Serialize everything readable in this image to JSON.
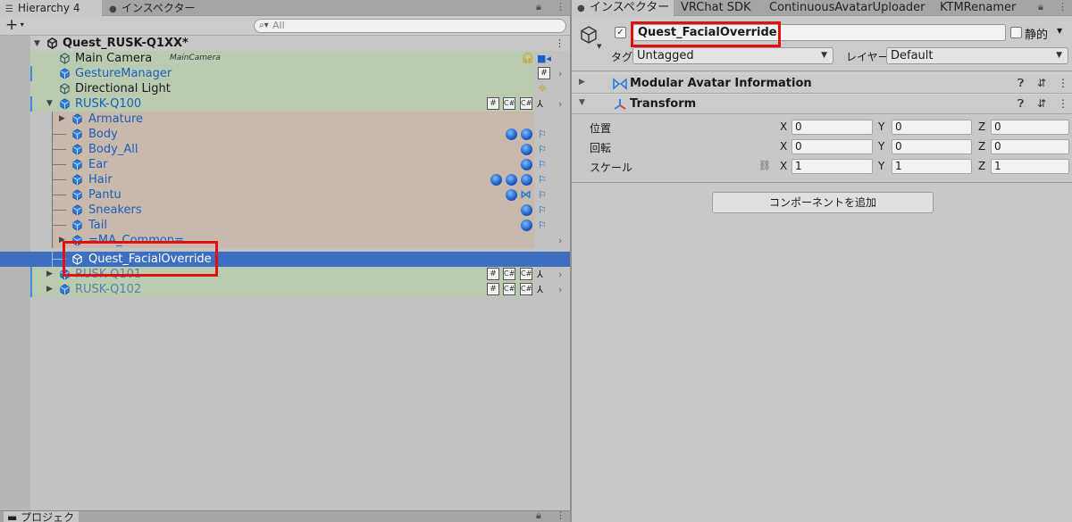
{
  "hierarchy": {
    "tab_label": "Hierarchy 4",
    "other_tab_label": "インスペクター",
    "add_label": "+",
    "search_placeholder": "All",
    "scene_name": "Quest_RUSK-Q1XX*",
    "items": [
      {
        "label": "Main Camera",
        "tag": "MainCamera"
      },
      {
        "label": "GestureManager"
      },
      {
        "label": "Directional Light"
      },
      {
        "label": "RUSK-Q100"
      },
      {
        "label": "Armature"
      },
      {
        "label": "Body"
      },
      {
        "label": "Body_All"
      },
      {
        "label": "Ear"
      },
      {
        "label": "Hair"
      },
      {
        "label": "Pantu"
      },
      {
        "label": "Sneakers"
      },
      {
        "label": "Tail"
      },
      {
        "label": "=MA_Common="
      },
      {
        "label": "Quest_FacialOverride"
      },
      {
        "label": "RUSK-Q101"
      },
      {
        "label": "RUSK-Q102"
      }
    ],
    "icon_glyphs": {
      "hash": "#",
      "script": "C#",
      "prefab": "⅄"
    }
  },
  "project": {
    "tab_label": "プロジェクト"
  },
  "inspector": {
    "tabs": [
      "インスペクター",
      "VRChat SDK",
      "ContinuousAvatarUploader",
      "KTMRenamer"
    ],
    "object_name": "Quest_FacialOverride",
    "active_checked": true,
    "static_label": "静的",
    "tag_label": "タグ",
    "tag_value": "Untagged",
    "layer_label": "レイヤー",
    "layer_value": "Default",
    "components": [
      {
        "title": "Modular Avatar Information",
        "icon": "modular-avatar-icon"
      },
      {
        "title": "Transform",
        "icon": "transform-icon"
      }
    ],
    "transform": {
      "position_label": "位置",
      "rotation_label": "回転",
      "scale_label": "スケール",
      "axes": [
        "X",
        "Y",
        "Z"
      ],
      "position": [
        "0",
        "0",
        "0"
      ],
      "rotation": [
        "0",
        "0",
        "0"
      ],
      "scale": [
        "1",
        "1",
        "1"
      ]
    },
    "add_component_label": "コンポーネントを追加"
  },
  "colors": {
    "selection": "#3d6ec0",
    "highlight_red": "#e01010",
    "root_green": "#b9cbb1",
    "child_tan": "#c9b9ac"
  }
}
